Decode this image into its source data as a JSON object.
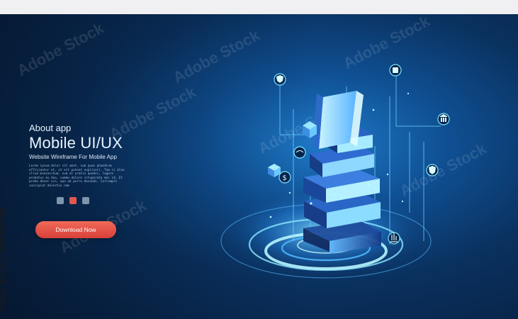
{
  "hero": {
    "eyebrow": "About app",
    "title": "Mobile  UI/UX",
    "subtitle": "Website Wireframe For Mobile App",
    "body_text": "Lorem ipsum dolor sit amet, sum quas phaedrum efficiantur et, ut eit putent expliceri. Tum si dico illud mnesarchum, sum at oratio quodsi, legere probatus eu duo, summo dolore vituperata mei id. Et probo deser vis, quo ad porro docendi. Corrumpit suscipiat delectus nam",
    "dots": [
      "#7e94ad",
      "#e1584f",
      "#7e94ad"
    ],
    "cta_label": "Download Now"
  },
  "watermark": {
    "side_text": "Adobe Stock | #501420456",
    "pattern_text": "Adobe Stock"
  },
  "icons": [
    "shield-icon",
    "book-icon",
    "bank-icon",
    "shield-badge-icon",
    "wifi-icon",
    "dollar-icon",
    "chart-icon",
    "box-icon"
  ]
}
